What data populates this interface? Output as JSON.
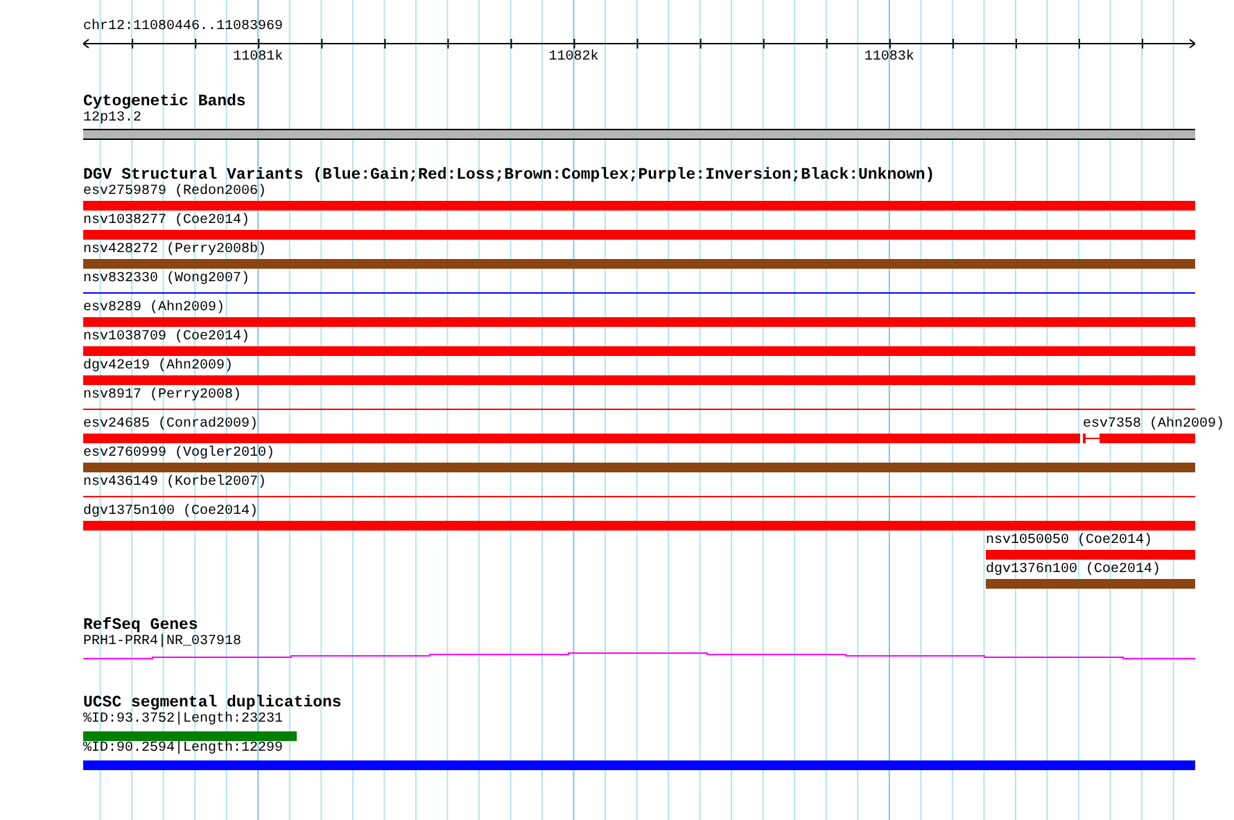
{
  "ruler": {
    "region": "chr12:11080446..11083969",
    "tick_labels": [
      "11081k",
      "11082k",
      "11083k"
    ]
  },
  "tracks": [
    {
      "kind": "cytoband",
      "title": "Cytogenetic Bands",
      "features": [
        {
          "label": "12p13.2"
        }
      ]
    },
    {
      "kind": "variants",
      "title": "DGV Structural Variants (Blue:Gain;Red:Loss;Brown:Complex;Purple:Inversion;Black:Unknown)",
      "rows": [
        [
          {
            "label": "esv2759879 (Redon2006)",
            "kind": "thick",
            "color": "#ff0000"
          }
        ],
        [
          {
            "label": "nsv1038277 (Coe2014)",
            "kind": "thick",
            "color": "#ff0000"
          }
        ],
        [
          {
            "label": "nsv428272 (Perry2008b)",
            "kind": "thick",
            "color": "#8b4513"
          }
        ],
        [
          {
            "label": "nsv832330 (Wong2007)",
            "kind": "thin",
            "color": "#0000ff"
          }
        ],
        [
          {
            "label": "esv8289 (Ahn2009)",
            "kind": "thick",
            "color": "#ff0000"
          }
        ],
        [
          {
            "label": "nsv1038709 (Coe2014)",
            "kind": "thick",
            "color": "#ff0000"
          }
        ],
        [
          {
            "label": "dgv42e19 (Ahn2009)",
            "kind": "thick",
            "color": "#ff0000"
          }
        ],
        [
          {
            "label": "nsv8917 (Perry2008)",
            "kind": "thin",
            "color": "#ff0000"
          }
        ],
        [
          {
            "label": "esv24685 (Conrad2009)",
            "kind": "thick",
            "color": "#ff0000"
          },
          {
            "label": "esv7358 (Ahn2009)",
            "kind": "split",
            "color": "#ff0000"
          }
        ],
        [
          {
            "label": "esv2760999 (Vogler2010)",
            "kind": "thick",
            "color": "#8b4513"
          }
        ],
        [
          {
            "label": "nsv436149 (Korbel2007)",
            "kind": "thin",
            "color": "#ff0000"
          }
        ],
        [
          {
            "label": "dgv1375n100 (Coe2014)",
            "kind": "thick",
            "color": "#ff0000"
          }
        ],
        [
          {
            "label": "nsv1050050 (Coe2014)",
            "kind": "thick",
            "color": "#ff0000"
          }
        ],
        [
          {
            "label": "dgv1376n100 (Coe2014)",
            "kind": "thick",
            "color": "#8b4513"
          }
        ]
      ]
    },
    {
      "kind": "gene",
      "title": "RefSeq Genes",
      "features": [
        {
          "label": "PRH1-PRR4|NR_037918"
        }
      ]
    },
    {
      "kind": "segdup",
      "title": "UCSC segmental duplications",
      "features": [
        {
          "label": "%ID:93.3752|Length:23231",
          "color": "#008000"
        },
        {
          "label": "%ID:90.2594|Length:12299",
          "color": "#0000ff"
        }
      ]
    }
  ]
}
